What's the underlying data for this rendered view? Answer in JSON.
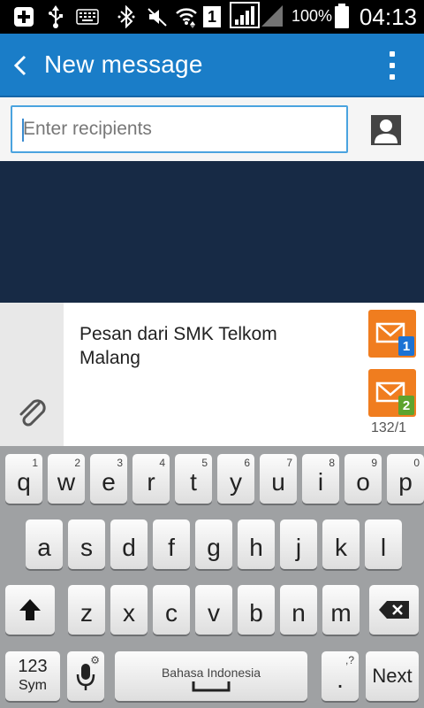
{
  "status_bar": {
    "battery_percent": "100%",
    "time": "04:13",
    "sim_number": "1"
  },
  "action_bar": {
    "title": "New message"
  },
  "recipients": {
    "placeholder": "Enter recipients",
    "value": ""
  },
  "compose": {
    "message_line_1": "Pesan dari SMK Telkom",
    "message_line_2": "Malang",
    "sim1_badge": "1",
    "sim2_badge": "2",
    "char_count": "132/1"
  },
  "keyboard": {
    "row1": [
      {
        "label": "q",
        "sup": "1"
      },
      {
        "label": "w",
        "sup": "2"
      },
      {
        "label": "e",
        "sup": "3"
      },
      {
        "label": "r",
        "sup": "4"
      },
      {
        "label": "t",
        "sup": "5"
      },
      {
        "label": "y",
        "sup": "6"
      },
      {
        "label": "u",
        "sup": "7"
      },
      {
        "label": "i",
        "sup": "8"
      },
      {
        "label": "o",
        "sup": "9"
      },
      {
        "label": "p",
        "sup": "0"
      }
    ],
    "row2": [
      "a",
      "s",
      "d",
      "f",
      "g",
      "h",
      "j",
      "k",
      "l"
    ],
    "row3": [
      "z",
      "x",
      "c",
      "v",
      "b",
      "n",
      "m"
    ],
    "sym_top": "123",
    "sym_bottom": "Sym",
    "space_label": "Bahasa Indonesia",
    "period": ".",
    "period_sup": ",?",
    "next_label": "Next"
  },
  "colors": {
    "action_bar": "#1a7dc8",
    "conversation_bg": "#172a45",
    "send_button": "#f07d1f",
    "sim1": "#1c72d4",
    "sim2": "#5ea32d",
    "keyboard_bg": "#9fa1a3"
  }
}
